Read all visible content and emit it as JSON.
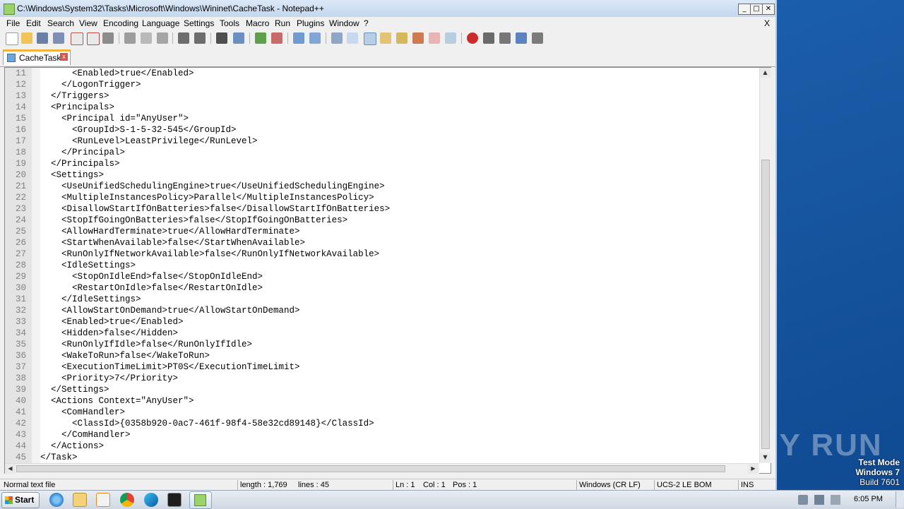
{
  "window": {
    "title": "C:\\Windows\\System32\\Tasks\\Microsoft\\Windows\\Wininet\\CacheTask - Notepad++",
    "minimize": "0",
    "maximize": "1",
    "close": "r"
  },
  "menu": [
    "File",
    "Edit",
    "Search",
    "View",
    "Encoding",
    "Language",
    "Settings",
    "Tools",
    "Macro",
    "Run",
    "Plugins",
    "Window",
    "?"
  ],
  "menu_close": "X",
  "toolbar_icons": [
    "new-file-icon",
    "open-file-icon",
    "save-icon",
    "save-all-icon",
    "close-icon",
    "close-all-icon",
    "print-icon",
    "cut-icon",
    "copy-icon",
    "paste-icon",
    "undo-icon",
    "redo-icon",
    "find-icon",
    "replace-icon",
    "zoom-in-icon",
    "zoom-out-icon",
    "sync-vertical-icon",
    "sync-horizontal-icon",
    "word-wrap-icon",
    "show-all-chars-icon",
    "indent-guide-icon",
    "user-language-icon",
    "document-map-icon",
    "function-list-icon",
    "folder-as-workspace-icon",
    "monitoring-icon",
    "record-macro-icon",
    "stop-recording-icon",
    "play-macro-icon",
    "run-macro-multiple-icon",
    "save-macro-icon"
  ],
  "tab": {
    "label": "CacheTask",
    "close": "x"
  },
  "lines": [
    {
      "n": "11",
      "t": "      <Enabled>true</Enabled>"
    },
    {
      "n": "12",
      "t": "    </LogonTrigger>"
    },
    {
      "n": "13",
      "t": "  </Triggers>"
    },
    {
      "n": "14",
      "t": "  <Principals>"
    },
    {
      "n": "15",
      "t": "    <Principal id=\"AnyUser\">"
    },
    {
      "n": "16",
      "t": "      <GroupId>S-1-5-32-545</GroupId>"
    },
    {
      "n": "17",
      "t": "      <RunLevel>LeastPrivilege</RunLevel>"
    },
    {
      "n": "18",
      "t": "    </Principal>"
    },
    {
      "n": "19",
      "t": "  </Principals>"
    },
    {
      "n": "20",
      "t": "  <Settings>"
    },
    {
      "n": "21",
      "t": "    <UseUnifiedSchedulingEngine>true</UseUnifiedSchedulingEngine>"
    },
    {
      "n": "22",
      "t": "    <MultipleInstancesPolicy>Parallel</MultipleInstancesPolicy>"
    },
    {
      "n": "23",
      "t": "    <DisallowStartIfOnBatteries>false</DisallowStartIfOnBatteries>"
    },
    {
      "n": "24",
      "t": "    <StopIfGoingOnBatteries>false</StopIfGoingOnBatteries>"
    },
    {
      "n": "25",
      "t": "    <AllowHardTerminate>true</AllowHardTerminate>"
    },
    {
      "n": "26",
      "t": "    <StartWhenAvailable>false</StartWhenAvailable>"
    },
    {
      "n": "27",
      "t": "    <RunOnlyIfNetworkAvailable>false</RunOnlyIfNetworkAvailable>"
    },
    {
      "n": "28",
      "t": "    <IdleSettings>"
    },
    {
      "n": "29",
      "t": "      <StopOnIdleEnd>false</StopOnIdleEnd>"
    },
    {
      "n": "30",
      "t": "      <RestartOnIdle>false</RestartOnIdle>"
    },
    {
      "n": "31",
      "t": "    </IdleSettings>"
    },
    {
      "n": "32",
      "t": "    <AllowStartOnDemand>true</AllowStartOnDemand>"
    },
    {
      "n": "33",
      "t": "    <Enabled>true</Enabled>"
    },
    {
      "n": "34",
      "t": "    <Hidden>false</Hidden>"
    },
    {
      "n": "35",
      "t": "    <RunOnlyIfIdle>false</RunOnlyIfIdle>"
    },
    {
      "n": "36",
      "t": "    <WakeToRun>false</WakeToRun>"
    },
    {
      "n": "37",
      "t": "    <ExecutionTimeLimit>PT0S</ExecutionTimeLimit>"
    },
    {
      "n": "38",
      "t": "    <Priority>7</Priority>"
    },
    {
      "n": "39",
      "t": "  </Settings>"
    },
    {
      "n": "40",
      "t": "  <Actions Context=\"AnyUser\">"
    },
    {
      "n": "41",
      "t": "    <ComHandler>"
    },
    {
      "n": "42",
      "t": "      <ClassId>{0358b920-0ac7-461f-98f4-58e32cd89148}</ClassId>"
    },
    {
      "n": "43",
      "t": "    </ComHandler>"
    },
    {
      "n": "44",
      "t": "  </Actions>"
    },
    {
      "n": "45",
      "t": "</Task>"
    }
  ],
  "statusbar": {
    "type": "Normal text file",
    "length": "length : 1,769",
    "lines": "lines : 45",
    "ln": "Ln : 1",
    "col": "Col : 1",
    "pos": "Pos : 1",
    "eol": "Windows (CR LF)",
    "encoding": "UCS-2 LE BOM",
    "mode": "INS"
  },
  "desktop": {
    "watermark": "ANY RUN",
    "testmode_1": "Test Mode",
    "testmode_2": "Windows 7",
    "testmode_3": "Build 7601"
  },
  "taskbar": {
    "start": "Start",
    "clock": "6:05 PM",
    "apps": [
      "internet-explorer-icon",
      "file-explorer-icon",
      "media-player-icon",
      "chrome-icon",
      "edge-icon",
      "cmd-icon",
      "notepad-plus-plus-icon"
    ],
    "tray": [
      "volume-icon",
      "network-icon",
      "action-center-flag-icon"
    ]
  },
  "colors": {
    "accent": "#1a5aa6",
    "tab_highlight": "#f0b43c",
    "gutter": "#e4e4e4"
  }
}
